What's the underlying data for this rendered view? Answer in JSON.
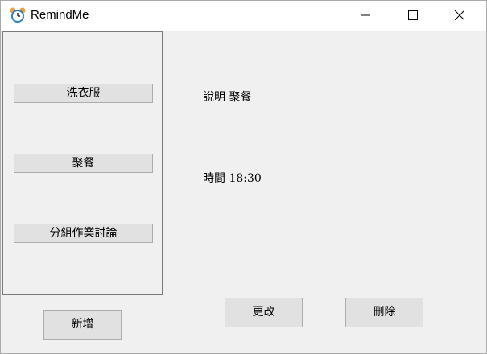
{
  "window": {
    "title": "RemindMe",
    "icon": "alarm-clock-icon"
  },
  "titlebar_buttons": [
    "minimize-icon",
    "maximize-icon",
    "close-icon"
  ],
  "reminders": [
    {
      "label": "洗衣服"
    },
    {
      "label": "聚餐"
    },
    {
      "label": "分組作業討論"
    }
  ],
  "detail": {
    "description": "說明 聚餐",
    "time": "時間 18:30"
  },
  "actions": {
    "add_label": "新增",
    "edit_label": "更改",
    "delete_label": "刪除"
  }
}
